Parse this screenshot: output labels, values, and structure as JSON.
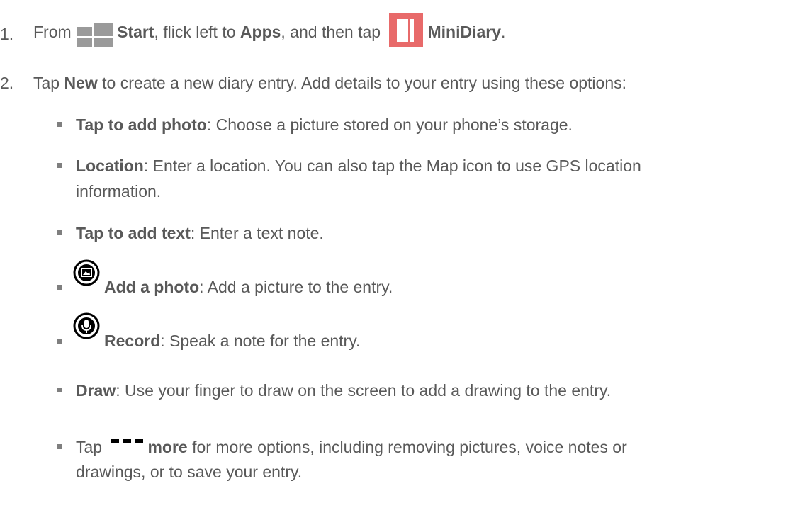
{
  "step1": {
    "number": "1.",
    "prefix": "From",
    "start_label": "Start",
    "mid_text": ", flick left to",
    "apps_label": "Apps",
    "then_text": ", and then tap",
    "app_name": "MiniDiary",
    "end": ".",
    "start_icon": "windows-start-icon",
    "app_icon": "minidiary-icon",
    "app_icon_color": "#e86a6a"
  },
  "step2": {
    "number": "2.",
    "tap": "Tap",
    "new_label": "New",
    "rest": "to create a new diary entry. Add details to your entry using these options:"
  },
  "options": [
    {
      "bold": "Tap to add photo",
      "text": ": Choose a picture stored on your phone’s storage."
    },
    {
      "bold": "Location",
      "text": ": Enter a location. You can also tap the Map icon to use GPS location",
      "text2": "information."
    },
    {
      "bold": "Tap to add text",
      "text": ": Enter a text note."
    },
    {
      "bold": "Add a photo",
      "text": ": Add a picture to the entry.",
      "icon": "add-photo-icon"
    },
    {
      "bold": "Record",
      "text": ": Speak a note for the entry.",
      "icon": "record-microphone-icon"
    },
    {
      "bold": "Draw",
      "text": ": Use your finger to draw on the screen to add a drawing to the entry."
    },
    {
      "tap": "Tap",
      "bold": "more",
      "text": "for more options, including removing pictures, voice notes or",
      "text2": "drawings, or to save your entry.",
      "icon": "more-dots-icon"
    }
  ]
}
